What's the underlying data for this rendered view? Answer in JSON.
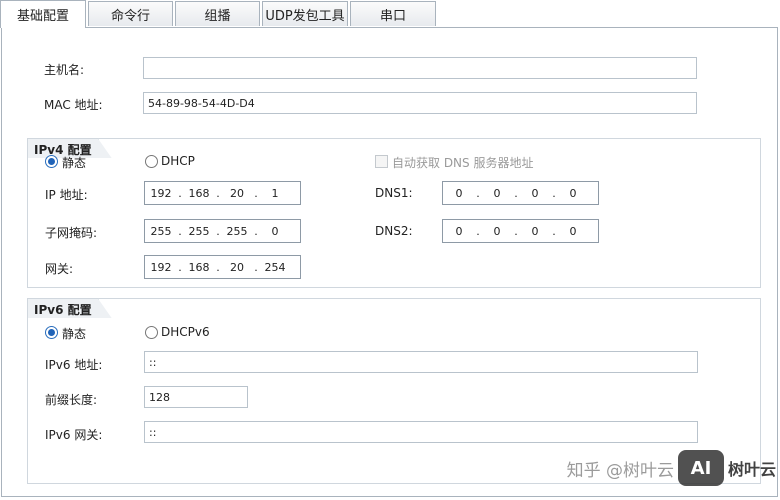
{
  "tabs": [
    {
      "label": "基础配置",
      "active": true
    },
    {
      "label": "命令行"
    },
    {
      "label": "组播"
    },
    {
      "label": "UDP发包工具"
    },
    {
      "label": "串口"
    }
  ],
  "basic": {
    "hostname_label": "主机名:",
    "hostname_value": "",
    "mac_label": "MAC 地址:",
    "mac_value": "54-89-98-54-4D-D4"
  },
  "ipv4": {
    "title": "IPv4 配置",
    "static_label": "静态",
    "dhcp_label": "DHCP",
    "auto_dns_label": "自动获取 DNS 服务器地址",
    "ip_label": "IP 地址:",
    "ip": [
      "192",
      "168",
      "20",
      "1"
    ],
    "mask_label": "子网掩码:",
    "mask": [
      "255",
      "255",
      "255",
      "0"
    ],
    "gateway_label": "网关:",
    "gateway": [
      "192",
      "168",
      "20",
      "254"
    ],
    "dns1_label": "DNS1:",
    "dns1": [
      "0",
      "0",
      "0",
      "0"
    ],
    "dns2_label": "DNS2:",
    "dns2": [
      "0",
      "0",
      "0",
      "0"
    ],
    "mode": "static"
  },
  "ipv6": {
    "title": "IPv6 配置",
    "static_label": "静态",
    "dhcp_label": "DHCPv6",
    "addr_label": "IPv6 地址:",
    "addr_value": "::",
    "prefix_label": "前缀长度:",
    "prefix_value": "128",
    "gateway_label": "IPv6 网关:",
    "gateway_value": "::",
    "mode": "static"
  },
  "watermark": {
    "text": "知乎 @树叶云",
    "logo": "AI",
    "brand": "树叶云"
  },
  "colors": {
    "accent": "#1f63b8",
    "border": "#a9b3bd"
  }
}
